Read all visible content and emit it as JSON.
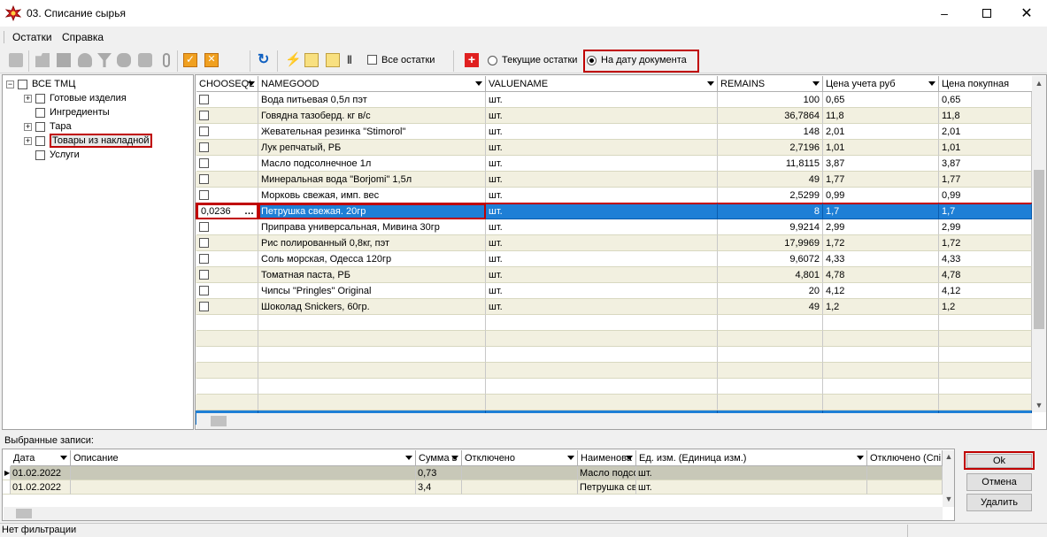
{
  "window": {
    "title": "03. Списание сырья"
  },
  "menu": [
    "Остатки",
    "Справка"
  ],
  "toolbar": {
    "all_remains_label": "Все остатки",
    "current_remains_label": "Текущие остатки",
    "on_doc_date_label": "На дату документа",
    "selected_radio": "На дату документа"
  },
  "tree": {
    "root": "ВСЕ ТМЦ",
    "items": [
      {
        "label": "Готовые изделия",
        "expandable": true
      },
      {
        "label": "Ингредиенты",
        "expandable": false
      },
      {
        "label": "Тара",
        "expandable": true
      },
      {
        "label": "Товары из накладной",
        "expandable": true,
        "selected": true
      },
      {
        "label": "Услуги",
        "expandable": false
      }
    ]
  },
  "grid": {
    "columns": [
      "CHOOSEQL",
      "NAMEGOOD",
      "VALUENAME",
      "REMAINS",
      "Цена учета руб",
      "Цена покупная"
    ],
    "rows": [
      {
        "choose": "",
        "name": "Вода питьевая 0,5л пэт",
        "unit": "шт.",
        "remains": "100",
        "price": "0,65",
        "buy": "0,65"
      },
      {
        "choose": "",
        "name": "Говядна тазоберд. кг в/с",
        "unit": "шт.",
        "remains": "36,7864",
        "price": "11,8",
        "buy": "11,8"
      },
      {
        "choose": "",
        "name": "Жевательная резинка \"Stimorol\"",
        "unit": "шт.",
        "remains": "148",
        "price": "2,01",
        "buy": "2,01"
      },
      {
        "choose": "",
        "name": "Лук репчатый, РБ",
        "unit": "шт.",
        "remains": "2,7196",
        "price": "1,01",
        "buy": "1,01"
      },
      {
        "choose": "",
        "name": "Масло подсолнечное 1л",
        "unit": "шт.",
        "remains": "11,8115",
        "price": "3,87",
        "buy": "3,87"
      },
      {
        "choose": "",
        "name": "Минеральная вода \"Borjomi\" 1,5л",
        "unit": "шт.",
        "remains": "49",
        "price": "1,77",
        "buy": "1,77"
      },
      {
        "choose": "",
        "name": "Морковь свежая, имп. вес",
        "unit": "шт.",
        "remains": "2,5299",
        "price": "0,99",
        "buy": "0,99"
      },
      {
        "choose": "0,0236",
        "name": "Петрушка свежая. 20гр",
        "unit": "шт.",
        "remains": "8",
        "price": "1,7",
        "buy": "1,7",
        "selected": true
      },
      {
        "choose": "",
        "name": "Приправа универсальная, Мивина 30гр",
        "unit": "шт.",
        "remains": "9,9214",
        "price": "2,99",
        "buy": "2,99"
      },
      {
        "choose": "",
        "name": "Рис полированный 0,8кг, пэт",
        "unit": "шт.",
        "remains": "17,9969",
        "price": "1,72",
        "buy": "1,72"
      },
      {
        "choose": "",
        "name": "Соль морская, Одесса 120гр",
        "unit": "шт.",
        "remains": "9,6072",
        "price": "4,33",
        "buy": "4,33"
      },
      {
        "choose": "",
        "name": "Томатная паста, РБ",
        "unit": "шт.",
        "remains": "4,801",
        "price": "4,78",
        "buy": "4,78"
      },
      {
        "choose": "",
        "name": "Чипсы \"Pringles\" Original",
        "unit": "шт.",
        "remains": "20",
        "price": "4,12",
        "buy": "4,12"
      },
      {
        "choose": "",
        "name": "Шоколад Snickers, 60гр.",
        "unit": "шт.",
        "remains": "49",
        "price": "1,2",
        "buy": "1,2"
      }
    ]
  },
  "selected_records": {
    "label": "Выбранные записи:",
    "columns": [
      "Дата",
      "Описание",
      "Сумма в",
      "Отключено",
      "Наименова",
      "Ед. изм. (Единица изм.)",
      "Отключено (Спі"
    ],
    "rows": [
      {
        "date": "01.02.2022",
        "desc": "",
        "sum": "0,73",
        "disabled": "",
        "name": "Масло подсо",
        "unit": "шт.",
        "disabled2": ""
      },
      {
        "date": "01.02.2022",
        "desc": "",
        "sum": "3,4",
        "disabled": "",
        "name": "Петрушка св",
        "unit": "шт.",
        "disabled2": ""
      }
    ]
  },
  "buttons": {
    "ok": "Ok",
    "cancel": "Отмена",
    "delete": "Удалить"
  },
  "status": {
    "text": "Нет фильтрации"
  }
}
